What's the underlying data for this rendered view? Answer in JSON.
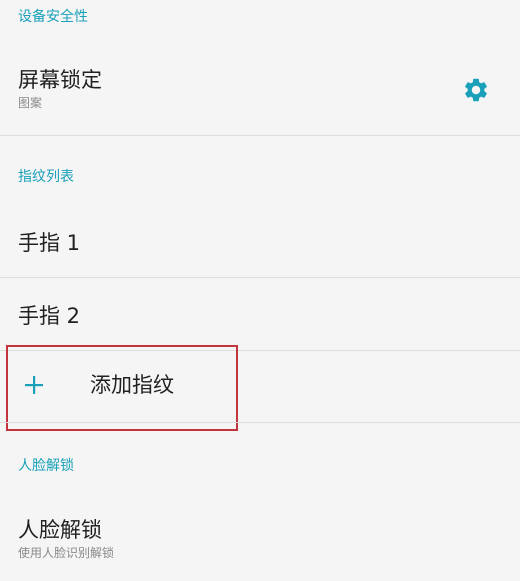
{
  "sections": {
    "device_security": {
      "header": "设备安全性"
    },
    "fingerprint_list": {
      "header": "指纹列表"
    },
    "face_unlock": {
      "header": "人脸解锁"
    }
  },
  "screen_lock": {
    "title": "屏幕锁定",
    "subtitle": "图案",
    "settings_icon": "gear-icon"
  },
  "fingerprints": [
    {
      "label": "手指 1"
    },
    {
      "label": "手指 2"
    }
  ],
  "add_fingerprint": {
    "label": "添加指纹",
    "icon": "plus-icon"
  },
  "face_unlock_item": {
    "title": "人脸解锁",
    "subtitle": "使用人脸识别解锁"
  },
  "colors": {
    "accent": "#1aa1b9",
    "highlight_border": "#c3353d",
    "background": "#f5f5f5"
  }
}
